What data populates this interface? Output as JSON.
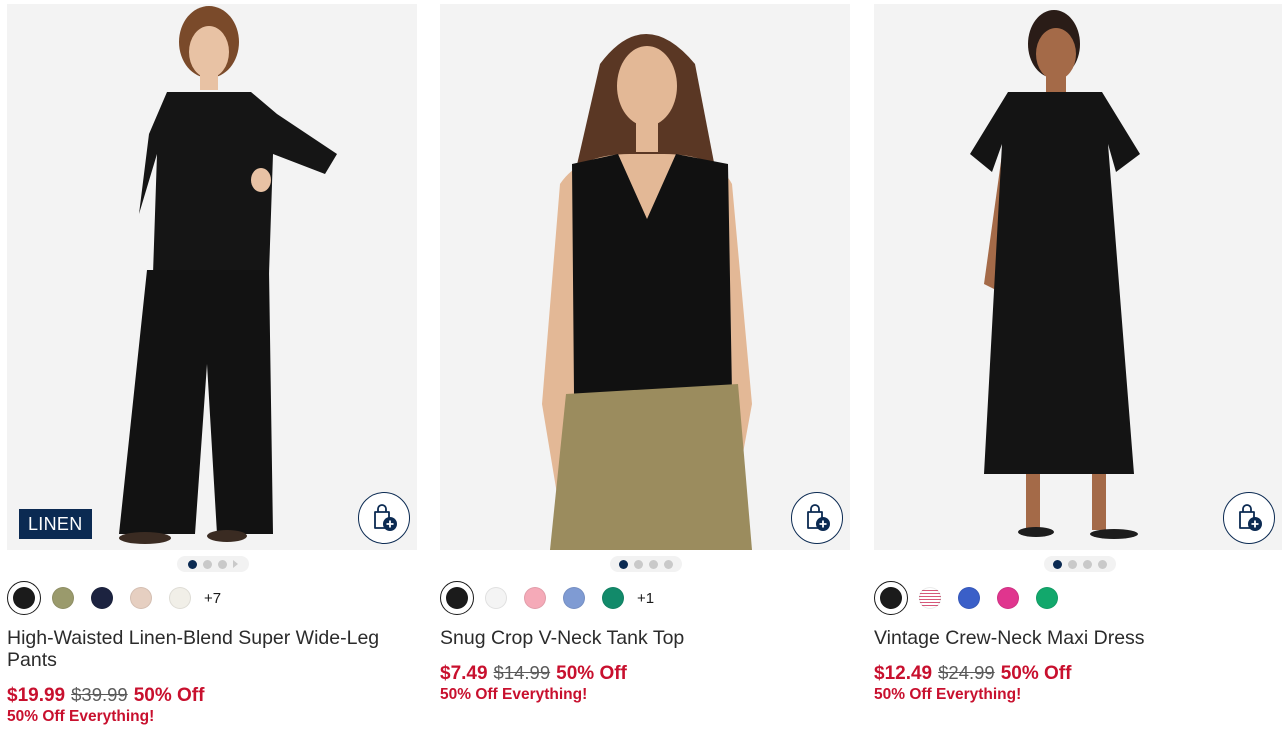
{
  "products": [
    {
      "badge": "LINEN",
      "name": "High-Waisted Linen-Blend Super Wide-Leg Pants",
      "sale_price": "$19.99",
      "original_price": "$39.99",
      "discount": "50% Off",
      "promo": "50% Off Everything!",
      "more_colors": "+7",
      "swatches": [
        "#1b1b1b",
        "#9a9a6c",
        "#1c2340",
        "#e6cfc1",
        "#f1efe8"
      ]
    },
    {
      "name": "Snug Crop V-Neck Tank Top",
      "sale_price": "$7.49",
      "original_price": "$14.99",
      "discount": "50% Off",
      "promo": "50% Off Everything!",
      "more_colors": "+1",
      "swatches": [
        "#1b1b1b",
        "#f4f4f4",
        "#f5aab8",
        "#7f9bd3",
        "#128a6a"
      ]
    },
    {
      "name": "Vintage Crew-Neck Maxi Dress",
      "sale_price": "$12.49",
      "original_price": "$24.99",
      "discount": "50% Off",
      "promo": "50% Off Everything!",
      "swatches": [
        "#1b1b1b",
        "striped",
        "#3a5fc8",
        "#e0358e",
        "#12a86c"
      ]
    }
  ],
  "icons": {
    "bag": "shopping-bag-plus-icon"
  },
  "colors": {
    "sale_red": "#c8102e",
    "navy": "#0b2a52"
  }
}
